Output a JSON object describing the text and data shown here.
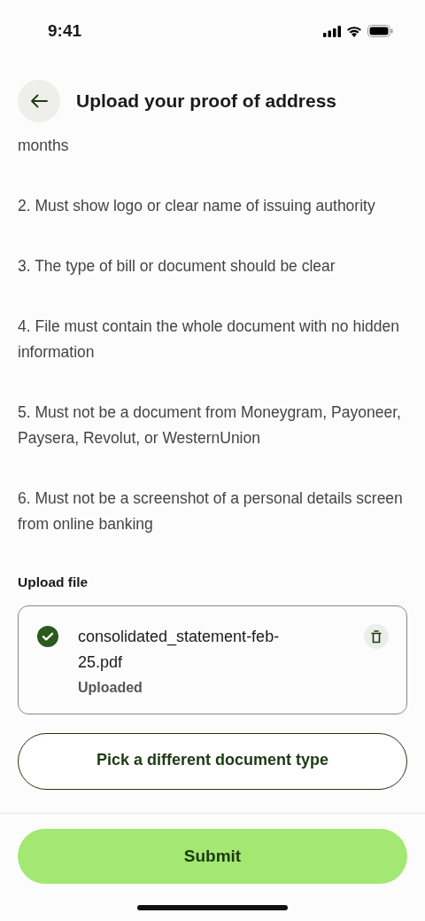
{
  "status_bar": {
    "time": "9:41"
  },
  "header": {
    "title": "Upload your proof of address"
  },
  "requirements": [
    "months",
    "2. Must show logo or clear name of issuing authority",
    "3. The type of bill or document should be clear",
    "4. File must contain the whole document with no hidden information",
    "5. Must not be a document from Moneygram, Payoneer, Paysera, Revolut, or WesternUnion",
    "6. Must not be a screenshot of a personal details screen from online banking"
  ],
  "upload": {
    "label": "Upload file",
    "file": {
      "name": "consolidated_statement-feb-25.pdf",
      "status": "Uploaded",
      "uploaded": true
    }
  },
  "buttons": {
    "secondary": "Pick a different document type",
    "primary": "Submit"
  }
}
